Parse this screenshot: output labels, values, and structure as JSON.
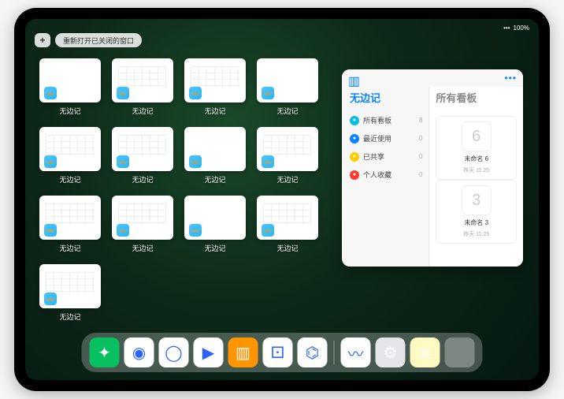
{
  "status": {
    "signal": "•••",
    "batt": "100%"
  },
  "topControls": {
    "plus": "+",
    "reopen": "重新打开已关闭的窗口"
  },
  "appSwitcher": {
    "label": "无边记",
    "cards": [
      {
        "type": "blank"
      },
      {
        "type": "grid"
      },
      {
        "type": "grid"
      },
      {
        "type": "blank"
      },
      {
        "type": "grid"
      },
      {
        "type": "grid"
      },
      {
        "type": "blank"
      },
      {
        "type": "grid"
      },
      {
        "type": "grid"
      },
      {
        "type": "grid"
      },
      {
        "type": "blank"
      },
      {
        "type": "grid"
      },
      {
        "type": "grid"
      }
    ]
  },
  "preview": {
    "leftTitle": "无边记",
    "rightTitle": "所有看板",
    "more": "•••",
    "sidebar": [
      {
        "icon": "all",
        "color": "#0abde3",
        "label": "所有看板",
        "count": "8"
      },
      {
        "icon": "recent",
        "color": "#0a84ff",
        "label": "最近使用",
        "count": "0"
      },
      {
        "icon": "shared",
        "color": "#ffcc00",
        "label": "已共享",
        "count": "0"
      },
      {
        "icon": "fave",
        "color": "#ff3b30",
        "label": "个人收藏",
        "count": "0"
      }
    ],
    "boards": [
      {
        "glyph": "6",
        "name": "未命名 6",
        "time": "昨天 11:25"
      },
      {
        "glyph": "3",
        "name": "未命名 3",
        "time": "昨天 11:25"
      }
    ]
  },
  "dock": {
    "icons": [
      {
        "name": "wechat",
        "bg": "#07C160",
        "glyph": "✦"
      },
      {
        "name": "quark-hd",
        "bg": "#ffffff",
        "glyph": "◉"
      },
      {
        "name": "quark",
        "bg": "#ffffff",
        "glyph": "◯"
      },
      {
        "name": "play",
        "bg": "#ffffff",
        "glyph": "▶"
      },
      {
        "name": "books",
        "bg": "#ff9500",
        "glyph": "▥"
      },
      {
        "name": "dice",
        "bg": "#ffffff",
        "glyph": "⚀"
      },
      {
        "name": "connect",
        "bg": "#ffffff",
        "glyph": "⌬"
      },
      {
        "name": "freeform",
        "bg": "#ffffff",
        "glyph": "〰"
      },
      {
        "name": "settings",
        "bg": "#e5e5ea",
        "glyph": "⚙"
      },
      {
        "name": "notes",
        "bg": "#fff9c4",
        "glyph": "≣"
      }
    ]
  }
}
